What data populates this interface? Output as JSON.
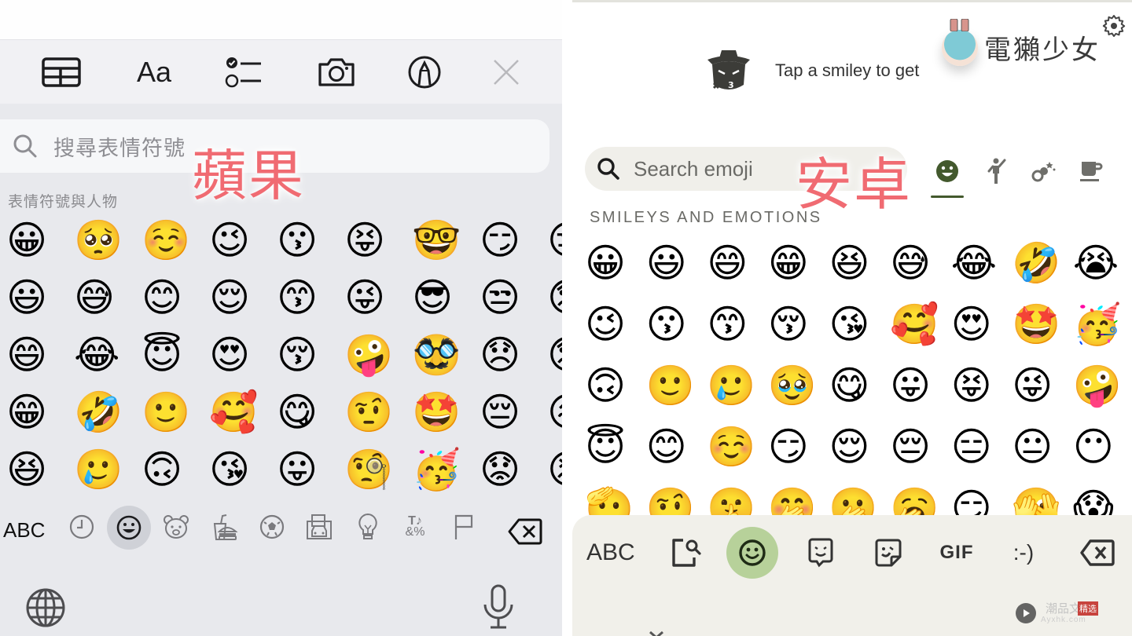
{
  "ios": {
    "overlay_label": "蘋果",
    "toolbar": {
      "items": [
        {
          "name": "table",
          "icon": "table-icon"
        },
        {
          "name": "format",
          "label": "Aa",
          "icon": "text-format-icon"
        },
        {
          "name": "checklist",
          "icon": "checklist-icon"
        },
        {
          "name": "camera",
          "icon": "camera-icon"
        },
        {
          "name": "markup",
          "icon": "markup-pen-icon"
        },
        {
          "name": "close",
          "icon": "close-icon"
        }
      ],
      "format_label": "Aa"
    },
    "search": {
      "placeholder": "搜尋表情符號"
    },
    "section_title": "表情符號與人物",
    "emoji_rows": [
      [
        "😀",
        "🥺",
        "☺️",
        "😉",
        "😗",
        "😝",
        "🤓",
        "😏",
        "😒"
      ],
      [
        "😃",
        "😅",
        "😊",
        "😌",
        "😙",
        "😜",
        "😎",
        "😒",
        "😞"
      ],
      [
        "😄",
        "😂",
        "😇",
        "😍",
        "😚",
        "🤪",
        "🥸",
        "😞",
        "😟"
      ],
      [
        "😁",
        "🤣",
        "🙂",
        "🥰",
        "😋",
        "🤨",
        "🤩",
        "😔",
        "😖"
      ],
      [
        "😆",
        "🥲",
        "🙃",
        "😘",
        "😛",
        "🧐",
        "🥳",
        "😟",
        "😣"
      ]
    ],
    "categories": {
      "abc_label": "ABC",
      "items": [
        {
          "name": "recent",
          "icon": "clock-icon"
        },
        {
          "name": "smileys",
          "icon": "smiley-icon",
          "active": true
        },
        {
          "name": "animals",
          "icon": "bear-icon"
        },
        {
          "name": "food",
          "icon": "burger-icon"
        },
        {
          "name": "activity",
          "icon": "soccer-ball-icon"
        },
        {
          "name": "travel",
          "icon": "building-car-icon"
        },
        {
          "name": "objects",
          "icon": "lightbulb-icon"
        },
        {
          "name": "symbols",
          "icon": "symbols-icon",
          "label": "&%"
        },
        {
          "name": "flags",
          "icon": "flag-icon"
        }
      ],
      "backspace": "backspace-icon"
    },
    "bottom": {
      "globe": "globe-icon",
      "mic": "microphone-icon"
    }
  },
  "android": {
    "overlay_label": "安卓",
    "tip_text": "Tap a smiley to get",
    "logo_text": "電獺少女",
    "search": {
      "placeholder": "Search emoji"
    },
    "tabs": [
      {
        "name": "smileys",
        "icon": "smiley-icon",
        "active": true
      },
      {
        "name": "people",
        "icon": "person-waving-icon"
      },
      {
        "name": "activities",
        "icon": "party-icon"
      },
      {
        "name": "food",
        "icon": "coffee-cup-icon"
      }
    ],
    "section_title": "SMILEYS AND EMOTIONS",
    "emoji_rows": [
      [
        "😀",
        "😃",
        "😄",
        "😁",
        "😆",
        "😅",
        "😂",
        "🤣",
        "😭"
      ],
      [
        "😉",
        "😗",
        "😙",
        "😚",
        "😘",
        "🥰",
        "😍",
        "🤩",
        "🥳"
      ],
      [
        "🙃",
        "🙂",
        "🥲",
        "🥹",
        "😋",
        "😛",
        "😝",
        "😜",
        "🤪"
      ],
      [
        "😇",
        "😊",
        "☺️",
        "😏",
        "😌",
        "😔",
        "😑",
        "😐",
        "😶"
      ],
      [
        "🫡",
        "🤨",
        "🤫",
        "🤭",
        "🫢",
        "🥱",
        "😏",
        "🫣",
        "😱"
      ]
    ],
    "bottom": {
      "abc_label": "ABC",
      "gif_label": "GIF",
      "emoticon_label": ":-)",
      "items": [
        {
          "name": "emoji-search",
          "icon": "sticker-search-icon"
        },
        {
          "name": "emoji",
          "icon": "smiley-icon",
          "active": true
        },
        {
          "name": "bitmoji",
          "icon": "bitmoji-icon"
        },
        {
          "name": "stickers",
          "icon": "sticker-icon"
        },
        {
          "name": "gif",
          "label": "GIF"
        },
        {
          "name": "emoticons",
          "label": ":-)"
        },
        {
          "name": "backspace",
          "icon": "backspace-icon"
        }
      ]
    },
    "watermark": {
      "text": "潮品文",
      "badge": "精选",
      "sub": "Ayxhk.com"
    }
  }
}
